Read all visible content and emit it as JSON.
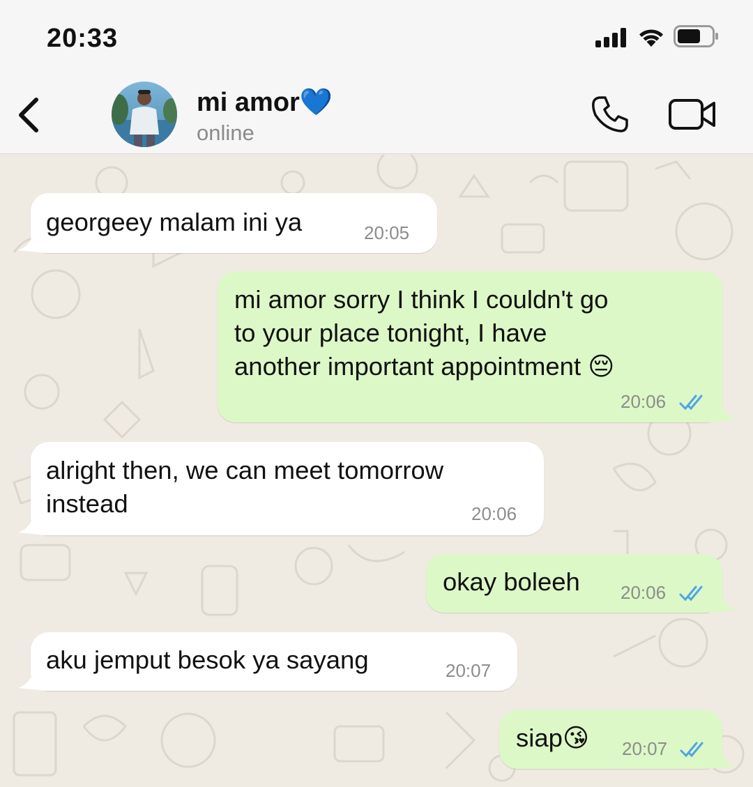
{
  "status_bar": {
    "time": "20:33"
  },
  "header": {
    "contact_name": "mi amor💙",
    "contact_status": "online",
    "icons": [
      "chevron-left-icon",
      "phone-icon",
      "video-camera-icon"
    ]
  },
  "colors": {
    "incoming_bubble": "#ffffff",
    "outgoing_bubble": "#dcf8c6",
    "read_tick": "#4fa3e8",
    "chat_background": "#efeae2"
  },
  "messages": [
    {
      "direction": "incoming",
      "text": "georgeey malam ini ya",
      "time": "20:05"
    },
    {
      "direction": "outgoing",
      "text": "mi amor sorry I think I couldn't go\nto your place tonight, I have\nanother important appointment 😔",
      "time": "20:06",
      "status": "read"
    },
    {
      "direction": "incoming",
      "text": "alright then, we can meet tomorrow\ninstead",
      "time": "20:06"
    },
    {
      "direction": "outgoing",
      "text": "okay boleeh",
      "time": "20:06",
      "status": "read"
    },
    {
      "direction": "incoming",
      "text": "aku jemput besok ya sayang",
      "time": "20:07"
    },
    {
      "direction": "outgoing",
      "text": "siap😘",
      "time": "20:07",
      "status": "read"
    }
  ]
}
